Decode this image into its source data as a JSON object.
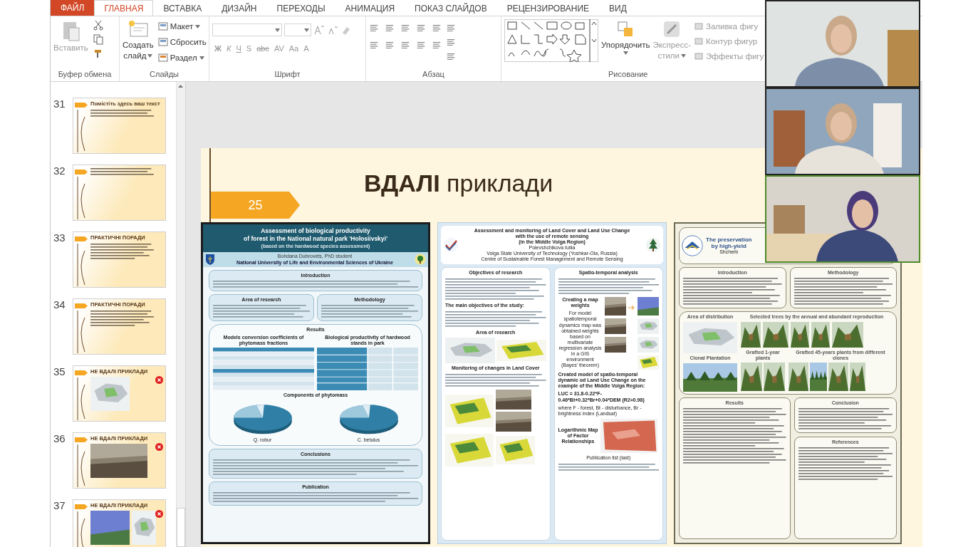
{
  "ribbon": {
    "file_tab": "ФАЙЛ",
    "tabs": [
      {
        "label": "ГЛАВНАЯ",
        "selected": true
      },
      {
        "label": "ВСТАВКА",
        "selected": false
      },
      {
        "label": "ДИЗАЙН",
        "selected": false
      },
      {
        "label": "ПЕРЕХОДЫ",
        "selected": false
      },
      {
        "label": "АНИМАЦИЯ",
        "selected": false
      },
      {
        "label": "ПОКАЗ СЛАЙДОВ",
        "selected": false
      },
      {
        "label": "РЕЦЕНЗИРОВАНИЕ",
        "selected": false
      },
      {
        "label": "ВИД",
        "selected": false
      }
    ],
    "clipboard": {
      "paste": "Вставить",
      "label": "Буфер обмена"
    },
    "slides": {
      "new_slide": [
        "Создать",
        "слайд"
      ],
      "items": [
        "Макет",
        "Сбросить",
        "Раздел"
      ],
      "label": "Слайды"
    },
    "font": {
      "buttons": [
        "Ж",
        "К",
        "Ч",
        "S",
        "abc",
        "AV",
        "Aa",
        "A"
      ],
      "label": "Шрифт"
    },
    "paragraph": {
      "label": "Абзац"
    },
    "drawing": {
      "arrange": "Упорядочить",
      "styles": [
        "Экспресс-",
        "стили"
      ],
      "commands": [
        "Заливка фигу",
        "Контур фигур",
        "Эффекты фигу"
      ],
      "label": "Рисование"
    }
  },
  "thumbnails": [
    {
      "number": "31",
      "heading": "Помістіть здесь ваш текст",
      "flagged": false
    },
    {
      "number": "32",
      "flagged": false
    },
    {
      "number": "33",
      "heading": "ПРАКТИЧНІ ПОРАДИ",
      "flagged": false
    },
    {
      "number": "34",
      "heading": "ПРАКТИЧНІ ПОРАДИ",
      "flagged": false
    },
    {
      "number": "35",
      "heading": "НЕ ВДАЛІ ПРИКЛАДИ",
      "flagged": true
    },
    {
      "number": "36",
      "heading": "НЕ ВДАЛІ ПРИКЛАДИ",
      "flagged": true
    },
    {
      "number": "37",
      "heading": "НЕ ВДАЛІ ПРИКЛАДИ",
      "flagged": true
    }
  ],
  "slide": {
    "title": "**ВДАЛІ** приклади",
    "number": "25",
    "posters": [
      {
        "kind": "teal",
        "title": [
          "Assessment of biological productivity",
          "of forest in the National natural park 'Holosiivskyi'"
        ],
        "subtitle": "(based on the hardwood species assessment)",
        "author": "Bohdana Dubrovets, PhD student",
        "org": "National University of Life and Environmental Sciences of Ukraine",
        "sections": [
          "Introduction",
          "Area of research",
          "Methodology",
          "Results",
          "Models conversion coefficients of phytomass fractions",
          "Biological productivity of hardwood stands in park",
          "Components of phytomass",
          "Conclusions",
          "Publication"
        ],
        "pie_labels": [
          "Q. robur",
          "C. betulus"
        ]
      },
      {
        "kind": "blue",
        "title": [
          "Assessment and monitoring of Land Cover and Land Use Change",
          "with the use of remote sensing",
          "(in the Middle Volga Region)"
        ],
        "author": "Polevshchikova Iuliia",
        "org": [
          "Volga State University of Technology (Yoshkar-Ola, Russia)",
          "Centre of Sustainable Forest Management and Remote Sensing"
        ],
        "sections": [
          "Objectives of research",
          "The main objectives of the study:",
          "Area of research",
          "Monitoring of changes in Land Cover",
          "Spatio-temporal analysis"
        ],
        "notes": [
          "Creating a map weights",
          "For model spatiotemporal dynamics map was obtained weights based on multivariate regression analysis in a GIS environment (Bayes' theorem)",
          "Created model of spatio-temporal dynamic od Land Use Change on the example of the Middle Volga Region:",
          "LUC = 31.8-0.22*F-0.46*Bt+0.32*Br+0.04*DEM (R2=0.98)",
          "where F - forest, Bt - disturbance, Br -brightness index (Landsat)",
          "Logarithmic Map of Factor Relationships",
          "Publication list (last)"
        ]
      },
      {
        "kind": "beige",
        "title": [
          "The preservation",
          "by high-yield"
        ],
        "author": "Shcherb",
        "sections": [
          "Introduction",
          "Methodology",
          "Area of distribution",
          "Selected trees by the annual and abundant reproduction",
          "Clonal Plantation",
          "Grafted 1-year plants",
          "Grafted 45-years plants from different clones",
          "Results",
          "Conclusion",
          "References"
        ]
      }
    ]
  },
  "video": {
    "tiles": [
      {
        "active": false
      },
      {
        "active": false
      },
      {
        "active": true
      }
    ]
  }
}
